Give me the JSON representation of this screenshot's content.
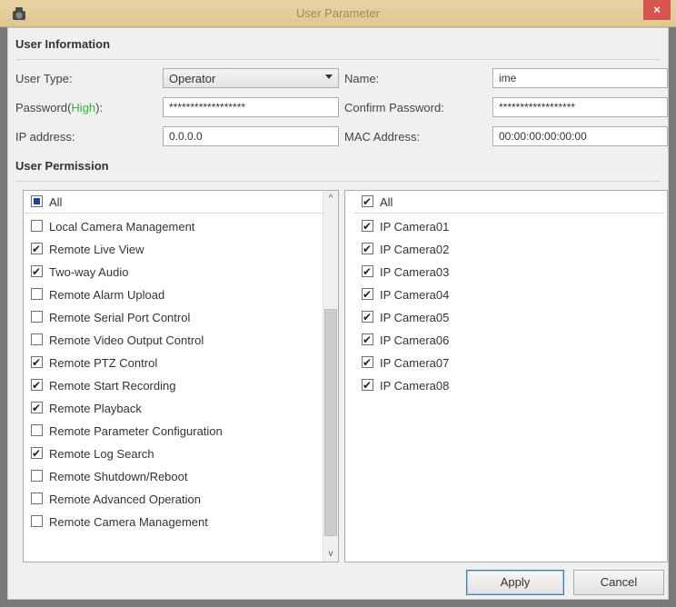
{
  "window": {
    "title": "User Parameter",
    "close_glyph": "×"
  },
  "user_info": {
    "section_title": "User Information",
    "user_type_label": "User Type:",
    "user_type_value": "Operator",
    "name_label": "Name:",
    "name_value": "ime",
    "password_label": "Password(",
    "password_strength": "High",
    "password_label_end": "):",
    "password_value": "******************",
    "confirm_password_label": "Confirm Password:",
    "confirm_password_value": "******************",
    "ip_label": "IP address:",
    "ip_value": "0.0.0.0",
    "mac_label": "MAC Address:",
    "mac_value": "00:00:00:00:00:00"
  },
  "permissions": {
    "section_title": "User Permission",
    "all_label": "All",
    "all_state": "partial",
    "items": [
      {
        "label": "Local Camera Management",
        "checked": false
      },
      {
        "label": "Remote Live View",
        "checked": true
      },
      {
        "label": "Two-way Audio",
        "checked": true
      },
      {
        "label": "Remote Alarm Upload",
        "checked": false
      },
      {
        "label": "Remote Serial Port Control",
        "checked": false
      },
      {
        "label": "Remote Video Output Control",
        "checked": false
      },
      {
        "label": "Remote PTZ Control",
        "checked": true
      },
      {
        "label": "Remote Start Recording",
        "checked": true
      },
      {
        "label": "Remote Playback",
        "checked": true
      },
      {
        "label": "Remote Parameter Configuration",
        "checked": false
      },
      {
        "label": "Remote Log Search",
        "checked": true
      },
      {
        "label": "Remote Shutdown/Reboot",
        "checked": false
      },
      {
        "label": "Remote Advanced Operation",
        "checked": false
      },
      {
        "label": "Remote Camera Management",
        "checked": false
      }
    ]
  },
  "cameras": {
    "all_label": "All",
    "all_checked": true,
    "items": [
      {
        "label": "IP Camera01",
        "checked": true
      },
      {
        "label": "IP Camera02",
        "checked": true
      },
      {
        "label": "IP Camera03",
        "checked": true
      },
      {
        "label": "IP Camera04",
        "checked": true
      },
      {
        "label": "IP Camera05",
        "checked": true
      },
      {
        "label": "IP Camera06",
        "checked": true
      },
      {
        "label": "IP Camera07",
        "checked": true
      },
      {
        "label": "IP Camera08",
        "checked": true
      }
    ]
  },
  "buttons": {
    "apply": "Apply",
    "cancel": "Cancel"
  },
  "scrollbar": {
    "up_glyph": "^",
    "down_glyph": "v"
  }
}
